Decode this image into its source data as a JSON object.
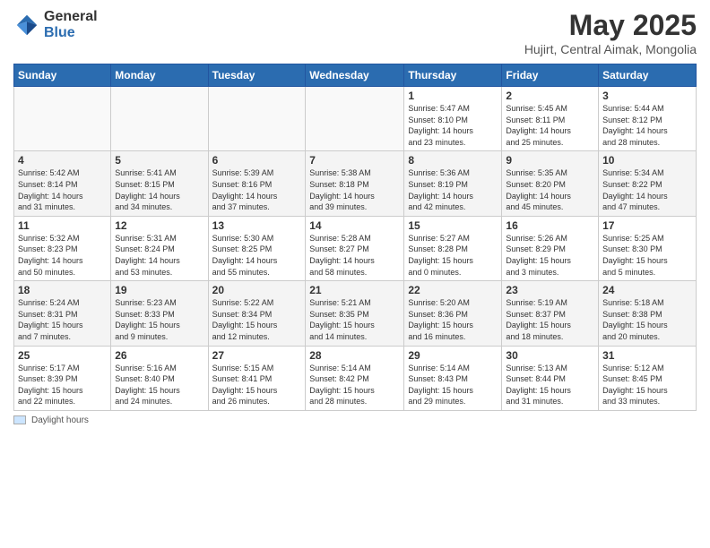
{
  "logo": {
    "general": "General",
    "blue": "Blue"
  },
  "title": "May 2025",
  "subtitle": "Hujirt, Central Aimak, Mongolia",
  "days_of_week": [
    "Sunday",
    "Monday",
    "Tuesday",
    "Wednesday",
    "Thursday",
    "Friday",
    "Saturday"
  ],
  "legend_label": "Daylight hours",
  "weeks": [
    [
      {
        "day": "",
        "info": ""
      },
      {
        "day": "",
        "info": ""
      },
      {
        "day": "",
        "info": ""
      },
      {
        "day": "",
        "info": ""
      },
      {
        "day": "1",
        "info": "Sunrise: 5:47 AM\nSunset: 8:10 PM\nDaylight: 14 hours\nand 23 minutes."
      },
      {
        "day": "2",
        "info": "Sunrise: 5:45 AM\nSunset: 8:11 PM\nDaylight: 14 hours\nand 25 minutes."
      },
      {
        "day": "3",
        "info": "Sunrise: 5:44 AM\nSunset: 8:12 PM\nDaylight: 14 hours\nand 28 minutes."
      }
    ],
    [
      {
        "day": "4",
        "info": "Sunrise: 5:42 AM\nSunset: 8:14 PM\nDaylight: 14 hours\nand 31 minutes."
      },
      {
        "day": "5",
        "info": "Sunrise: 5:41 AM\nSunset: 8:15 PM\nDaylight: 14 hours\nand 34 minutes."
      },
      {
        "day": "6",
        "info": "Sunrise: 5:39 AM\nSunset: 8:16 PM\nDaylight: 14 hours\nand 37 minutes."
      },
      {
        "day": "7",
        "info": "Sunrise: 5:38 AM\nSunset: 8:18 PM\nDaylight: 14 hours\nand 39 minutes."
      },
      {
        "day": "8",
        "info": "Sunrise: 5:36 AM\nSunset: 8:19 PM\nDaylight: 14 hours\nand 42 minutes."
      },
      {
        "day": "9",
        "info": "Sunrise: 5:35 AM\nSunset: 8:20 PM\nDaylight: 14 hours\nand 45 minutes."
      },
      {
        "day": "10",
        "info": "Sunrise: 5:34 AM\nSunset: 8:22 PM\nDaylight: 14 hours\nand 47 minutes."
      }
    ],
    [
      {
        "day": "11",
        "info": "Sunrise: 5:32 AM\nSunset: 8:23 PM\nDaylight: 14 hours\nand 50 minutes."
      },
      {
        "day": "12",
        "info": "Sunrise: 5:31 AM\nSunset: 8:24 PM\nDaylight: 14 hours\nand 53 minutes."
      },
      {
        "day": "13",
        "info": "Sunrise: 5:30 AM\nSunset: 8:25 PM\nDaylight: 14 hours\nand 55 minutes."
      },
      {
        "day": "14",
        "info": "Sunrise: 5:28 AM\nSunset: 8:27 PM\nDaylight: 14 hours\nand 58 minutes."
      },
      {
        "day": "15",
        "info": "Sunrise: 5:27 AM\nSunset: 8:28 PM\nDaylight: 15 hours\nand 0 minutes."
      },
      {
        "day": "16",
        "info": "Sunrise: 5:26 AM\nSunset: 8:29 PM\nDaylight: 15 hours\nand 3 minutes."
      },
      {
        "day": "17",
        "info": "Sunrise: 5:25 AM\nSunset: 8:30 PM\nDaylight: 15 hours\nand 5 minutes."
      }
    ],
    [
      {
        "day": "18",
        "info": "Sunrise: 5:24 AM\nSunset: 8:31 PM\nDaylight: 15 hours\nand 7 minutes."
      },
      {
        "day": "19",
        "info": "Sunrise: 5:23 AM\nSunset: 8:33 PM\nDaylight: 15 hours\nand 9 minutes."
      },
      {
        "day": "20",
        "info": "Sunrise: 5:22 AM\nSunset: 8:34 PM\nDaylight: 15 hours\nand 12 minutes."
      },
      {
        "day": "21",
        "info": "Sunrise: 5:21 AM\nSunset: 8:35 PM\nDaylight: 15 hours\nand 14 minutes."
      },
      {
        "day": "22",
        "info": "Sunrise: 5:20 AM\nSunset: 8:36 PM\nDaylight: 15 hours\nand 16 minutes."
      },
      {
        "day": "23",
        "info": "Sunrise: 5:19 AM\nSunset: 8:37 PM\nDaylight: 15 hours\nand 18 minutes."
      },
      {
        "day": "24",
        "info": "Sunrise: 5:18 AM\nSunset: 8:38 PM\nDaylight: 15 hours\nand 20 minutes."
      }
    ],
    [
      {
        "day": "25",
        "info": "Sunrise: 5:17 AM\nSunset: 8:39 PM\nDaylight: 15 hours\nand 22 minutes."
      },
      {
        "day": "26",
        "info": "Sunrise: 5:16 AM\nSunset: 8:40 PM\nDaylight: 15 hours\nand 24 minutes."
      },
      {
        "day": "27",
        "info": "Sunrise: 5:15 AM\nSunset: 8:41 PM\nDaylight: 15 hours\nand 26 minutes."
      },
      {
        "day": "28",
        "info": "Sunrise: 5:14 AM\nSunset: 8:42 PM\nDaylight: 15 hours\nand 28 minutes."
      },
      {
        "day": "29",
        "info": "Sunrise: 5:14 AM\nSunset: 8:43 PM\nDaylight: 15 hours\nand 29 minutes."
      },
      {
        "day": "30",
        "info": "Sunrise: 5:13 AM\nSunset: 8:44 PM\nDaylight: 15 hours\nand 31 minutes."
      },
      {
        "day": "31",
        "info": "Sunrise: 5:12 AM\nSunset: 8:45 PM\nDaylight: 15 hours\nand 33 minutes."
      }
    ]
  ]
}
